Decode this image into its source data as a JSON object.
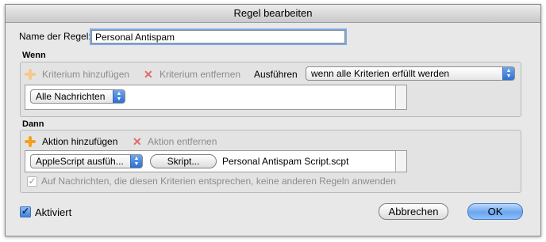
{
  "window": {
    "title": "Regel bearbeiten"
  },
  "rule_name": {
    "label": "Name der Regel:",
    "value": "Personal Antispam"
  },
  "when_section": {
    "title": "Wenn",
    "add_criterion": "Kriterium hinzufügen",
    "remove_criterion": "Kriterium entfernen",
    "execute_label": "Ausführen",
    "execute_value": "wenn alle Kriterien erfüllt werden",
    "criterion_popup": "Alle Nachrichten"
  },
  "then_section": {
    "title": "Dann",
    "add_action": "Aktion hinzufügen",
    "remove_action": "Aktion entfernen",
    "action_popup": "AppleScript ausfüh...",
    "script_button": "Skript...",
    "script_name": "Personal Antispam Script.scpt",
    "no_other_rules": "Auf Nachrichten, die diesen Kriterien entsprechen, keine anderen Regeln anwenden"
  },
  "footer": {
    "active_label": "Aktiviert",
    "cancel": "Abbrechen",
    "ok": "OK"
  }
}
